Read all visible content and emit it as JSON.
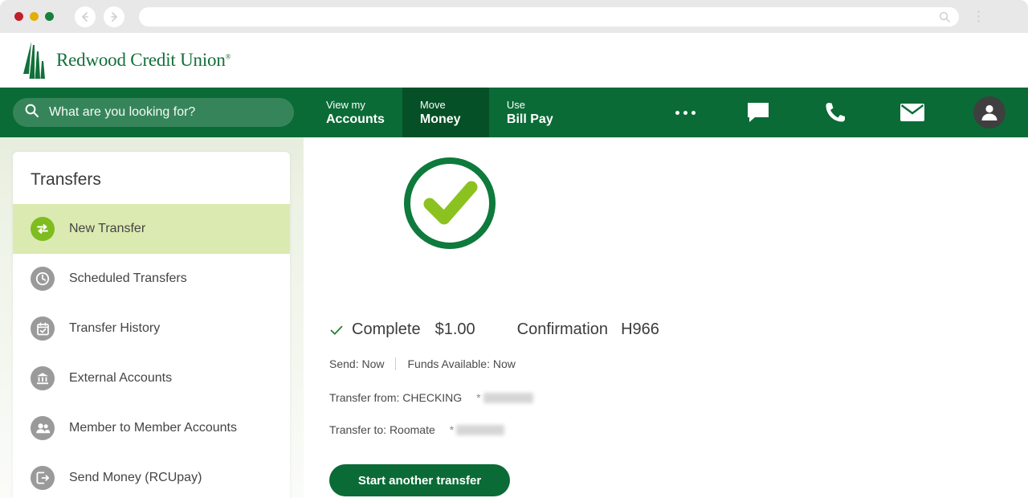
{
  "browser": {
    "traffic_lights": [
      "close",
      "minimize",
      "maximize"
    ],
    "back_label": "Back",
    "forward_label": "Forward",
    "url_value": "",
    "url_placeholder": "",
    "menu_label": "Browser menu"
  },
  "header": {
    "brand_name": "Redwood Credit Union",
    "brand_tm": "®",
    "brand_color": "#12703a"
  },
  "nav": {
    "search": {
      "placeholder": "What are you looking for?",
      "value": ""
    },
    "tabs": [
      {
        "small": "View my",
        "big": "Accounts",
        "active": false
      },
      {
        "small": "Move",
        "big": "Money",
        "active": true
      },
      {
        "small": "Use",
        "big": "Bill Pay",
        "active": false
      }
    ],
    "icons": [
      {
        "name": "more-options",
        "glyph": "dots"
      },
      {
        "name": "chat",
        "glyph": "chat"
      },
      {
        "name": "phone",
        "glyph": "phone"
      },
      {
        "name": "mail",
        "glyph": "mail"
      },
      {
        "name": "user-account",
        "glyph": "avatar"
      }
    ],
    "bar_color": "#0a6b36",
    "active_tab_color": "#055026"
  },
  "sidebar": {
    "title": "Transfers",
    "items": [
      {
        "label": "New Transfer",
        "icon": "transfer-arrows-icon",
        "active": true
      },
      {
        "label": "Scheduled Transfers",
        "icon": "clock-icon",
        "active": false
      },
      {
        "label": "Transfer History",
        "icon": "calendar-check-icon",
        "active": false
      },
      {
        "label": "External Accounts",
        "icon": "bank-icon",
        "active": false
      },
      {
        "label": "Member to Member Accounts",
        "icon": "people-icon",
        "active": false
      },
      {
        "label": "Send Money (RCUpay)",
        "icon": "send-money-icon",
        "active": false
      }
    ],
    "active_bg": "#dbeab0",
    "active_icon_color": "#7ebc1f"
  },
  "main": {
    "success_icon": "check-circle-icon",
    "status_label": "Complete",
    "amount": "$1.00",
    "confirmation_label": "Confirmation",
    "confirmation_code": "H966",
    "send_label": "Send: Now",
    "funds_label": "Funds Available: Now",
    "transfer_from_label": "Transfer from: CHECKING",
    "transfer_from_mask": "*",
    "transfer_to_label": "Transfer to: Roomate",
    "transfer_to_mask": "*",
    "cta_label": "Start another transfer",
    "cta_color": "#0a6b36",
    "check_ring_color": "#0e7a3c",
    "check_mark_color": "#8bc220"
  }
}
